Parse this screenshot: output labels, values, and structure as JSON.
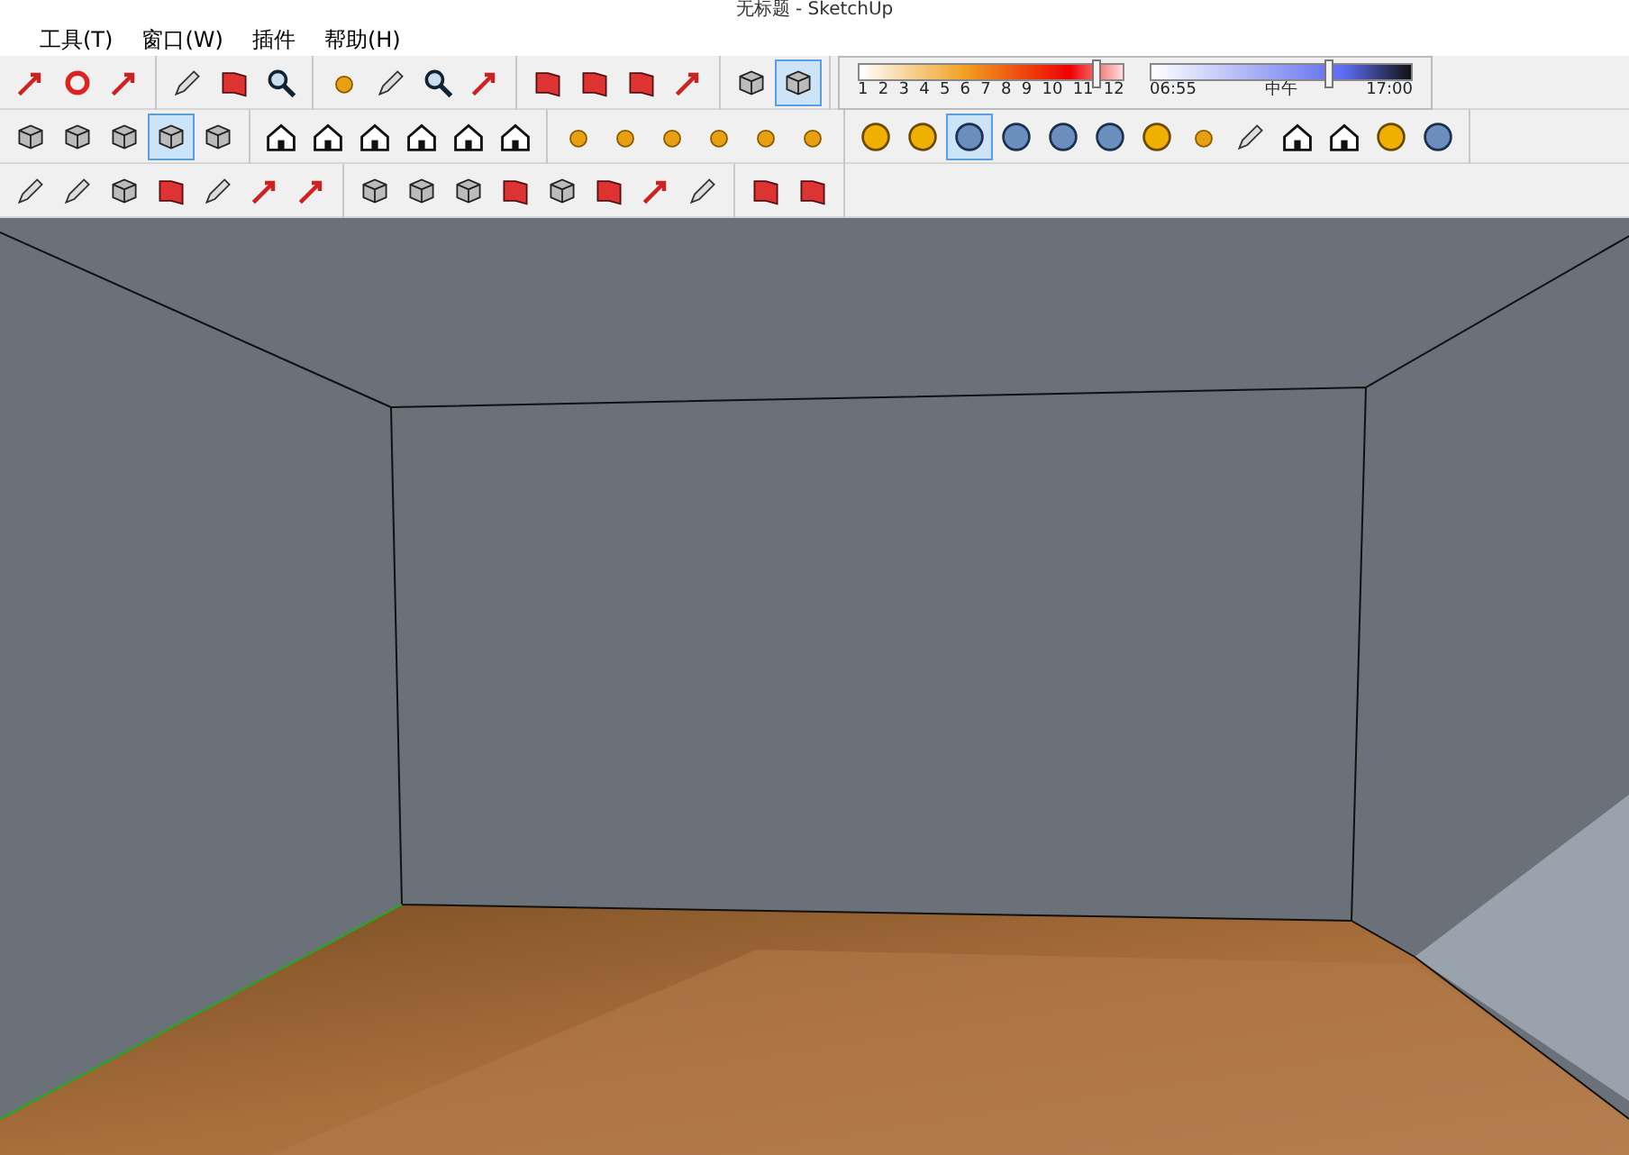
{
  "window": {
    "title": "无标题 - SketchUp"
  },
  "menu": [
    "工具(T)",
    "窗口(W)",
    "插件",
    "帮助(H)"
  ],
  "toolbars": [
    [
      [
        {
          "selected": false
        },
        {
          "selected": false
        },
        {
          "selected": false
        }
      ],
      [
        {
          "selected": false
        },
        {
          "selected": false
        },
        {
          "selected": false
        }
      ],
      [
        {
          "selected": false
        },
        {
          "selected": false
        },
        {
          "selected": false
        },
        {
          "selected": false
        }
      ],
      [
        {
          "selected": false
        },
        {
          "selected": false
        },
        {
          "selected": false
        },
        {
          "selected": false
        }
      ],
      [
        {
          "selected": false
        },
        {
          "selected": true
        }
      ]
    ],
    [
      [
        {
          "selected": false
        },
        {
          "selected": false
        },
        {
          "selected": false
        },
        {
          "selected": true
        },
        {
          "selected": false
        }
      ],
      [
        {
          "selected": false
        },
        {
          "selected": false
        },
        {
          "selected": false
        },
        {
          "selected": false
        },
        {
          "selected": false
        },
        {
          "selected": false
        }
      ],
      [
        {
          "selected": false
        },
        {
          "selected": false
        },
        {
          "selected": false
        },
        {
          "selected": false
        },
        {
          "selected": false
        },
        {
          "selected": false
        }
      ],
      [
        {
          "selected": false
        },
        {
          "selected": false
        },
        {
          "selected": true
        },
        {
          "selected": false
        },
        {
          "selected": false
        },
        {
          "selected": false
        },
        {
          "selected": false
        },
        {
          "selected": false
        },
        {
          "selected": false
        },
        {
          "selected": false
        },
        {
          "selected": false
        },
        {
          "selected": false
        },
        {
          "selected": false
        }
      ]
    ],
    [
      [
        {
          "selected": false
        },
        {
          "selected": false
        },
        {
          "selected": false
        },
        {
          "selected": false
        },
        {
          "selected": false
        },
        {
          "selected": false
        },
        {
          "selected": false
        }
      ],
      [
        {
          "selected": false
        },
        {
          "selected": false
        },
        {
          "selected": false
        },
        {
          "selected": false
        },
        {
          "selected": false
        },
        {
          "selected": false
        },
        {
          "selected": false
        },
        {
          "selected": false
        }
      ],
      [
        {
          "selected": false
        },
        {
          "selected": false
        }
      ]
    ]
  ],
  "shadow_month": {
    "level": 0.9,
    "ticks": [
      "1",
      "2",
      "3",
      "4",
      "5",
      "6",
      "7",
      "8",
      "9",
      "10",
      "11",
      "12"
    ]
  },
  "shadow_time": {
    "level": 0.68,
    "start": "06:55",
    "middle": "中午",
    "end": "17:00"
  }
}
